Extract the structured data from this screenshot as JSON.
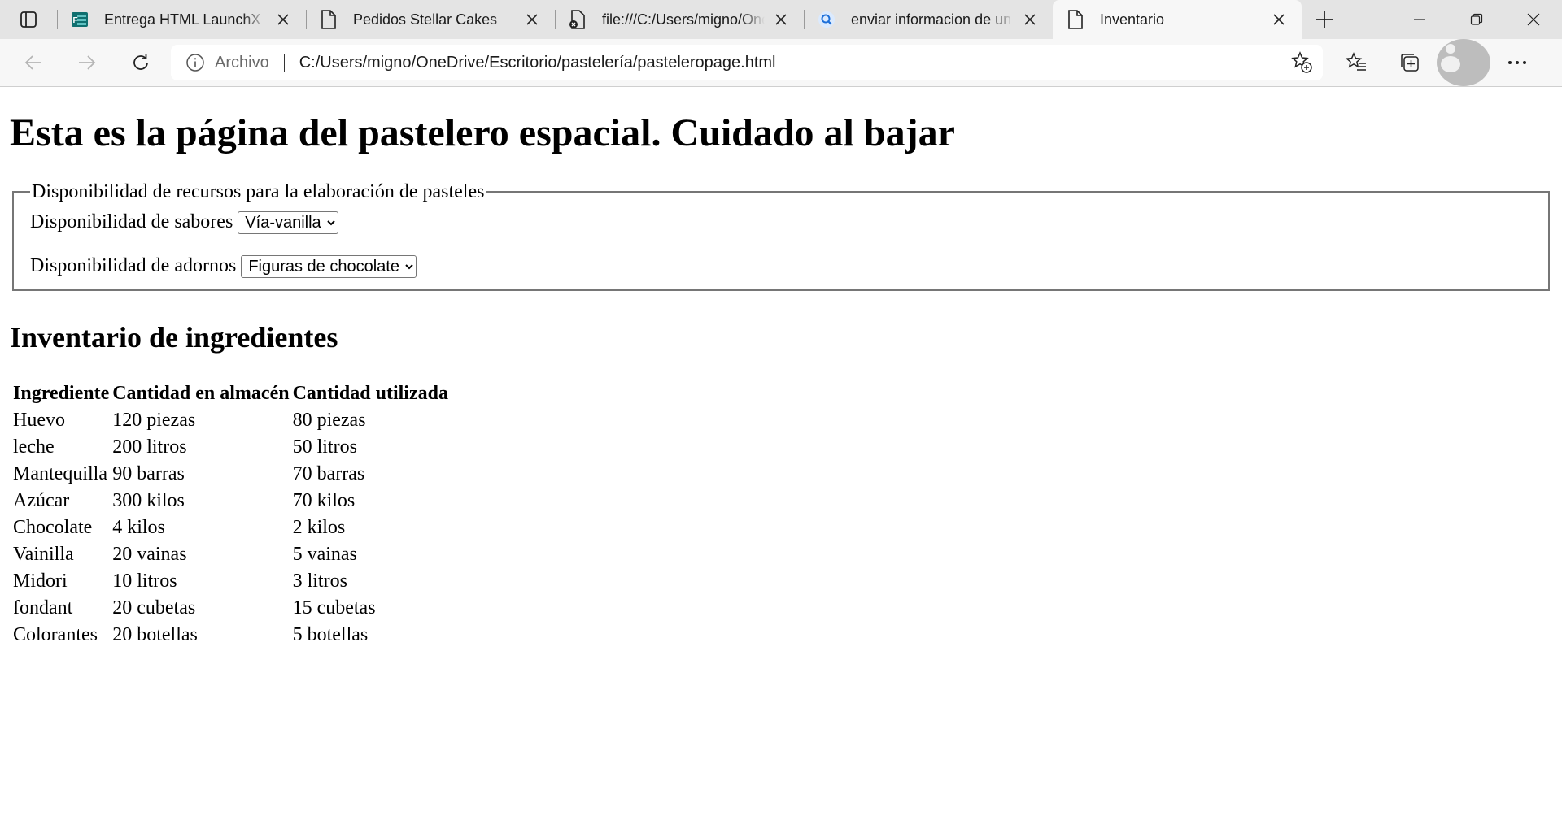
{
  "browser": {
    "tabs": [
      {
        "title": "Entrega HTML LaunchX",
        "favicon": "forms-icon",
        "active": false
      },
      {
        "title": "Pedidos Stellar Cakes",
        "favicon": "page-icon",
        "active": false
      },
      {
        "title": "file:///C:/Users/migno/OneDrive",
        "favicon": "broken-file-icon",
        "active": false
      },
      {
        "title": "enviar informacion de un formulario",
        "favicon": "search-icon",
        "active": false
      },
      {
        "title": "Inventario",
        "favicon": "page-icon",
        "active": true
      }
    ],
    "address": {
      "protocol_label": "Archivo",
      "url": "C:/Users/migno/OneDrive/Escritorio/pastelería/pasteleropage.html"
    },
    "colors": {
      "tabstrip": "#e4e4e4",
      "toolbar": "#f7f7f7",
      "forms_icon": "#0f6f6f"
    }
  },
  "page": {
    "heading": "Esta es la página del pastelero espacial. Cuidado al bajar",
    "fieldset": {
      "legend": "Disponibilidad de recursos para la elaboración de pasteles",
      "flavors_label": "Disponibilidad de sabores",
      "flavors_selected": "Vía-vanilla",
      "decorations_label": "Disponibilidad de adornos",
      "decorations_selected": "Figuras de chocolate"
    },
    "inventory": {
      "title": "Inventario de ingredientes",
      "headers": [
        "Ingrediente",
        "Cantidad en almacén",
        "Cantidad utilizada"
      ],
      "rows": [
        [
          "Huevo",
          "120 piezas",
          "80 piezas"
        ],
        [
          "leche",
          "200 litros",
          "50 litros"
        ],
        [
          "Mantequilla",
          "90 barras",
          "70 barras"
        ],
        [
          "Azúcar",
          "300 kilos",
          "70 kilos"
        ],
        [
          "Chocolate",
          "4 kilos",
          "2 kilos"
        ],
        [
          "Vainilla",
          "20 vainas",
          "5 vainas"
        ],
        [
          "Midori",
          "10 litros",
          "3 litros"
        ],
        [
          "fondant",
          "20 cubetas",
          "15 cubetas"
        ],
        [
          "Colorantes",
          "20 botellas",
          "5 botellas"
        ]
      ]
    }
  }
}
